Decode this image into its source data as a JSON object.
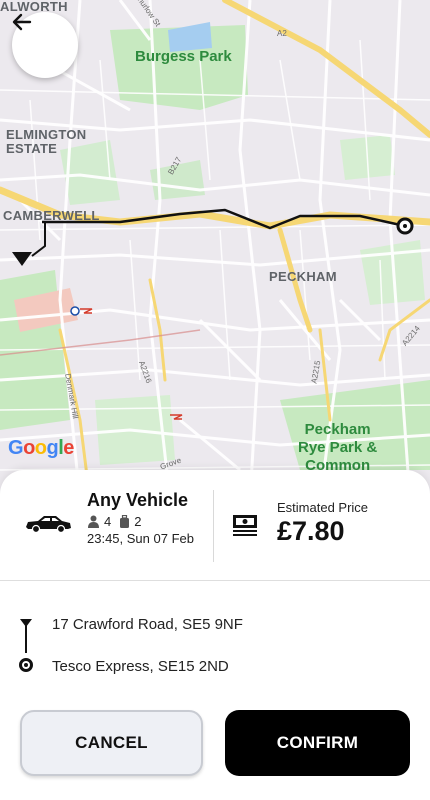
{
  "map": {
    "labels": {
      "walworth": "ALWORTH",
      "burgess_park": "Burgess Park",
      "elmington_estate": "ELMINGTON\nESTATE",
      "camberwell": "CAMBERWELL",
      "peckham": "PECKHAM",
      "peckham_rye": "Peckham\nRye Park &\nCommon",
      "thurlow_st": "Thurlow St",
      "a2": "A2",
      "b217": "B217",
      "a2216": "A2216",
      "a2215": "A2215",
      "a2214": "A2214",
      "denmark_hill": "Denmark Hill",
      "grove": "Grove"
    },
    "google_logo": "Google",
    "route_color": "#111111",
    "road_yellow": "#f6d774",
    "park_green": "#b5e3b0",
    "water_blue": "#9dc9ef"
  },
  "back_button": {
    "icon": "arrow-left-icon"
  },
  "vehicle": {
    "icon": "car-icon",
    "name": "Any Vehicle",
    "passengers": "4",
    "luggage": "2",
    "datetime": "23:45, Sun 07 Feb"
  },
  "price": {
    "icon": "cash-icon",
    "caption": "Estimated Price",
    "value": "£7.80"
  },
  "route": {
    "pickup": "17 Crawford Road, SE5 9NF",
    "dropoff": "Tesco Express, SE15 2ND"
  },
  "actions": {
    "cancel_label": "CANCEL",
    "confirm_label": "CONFIRM"
  }
}
